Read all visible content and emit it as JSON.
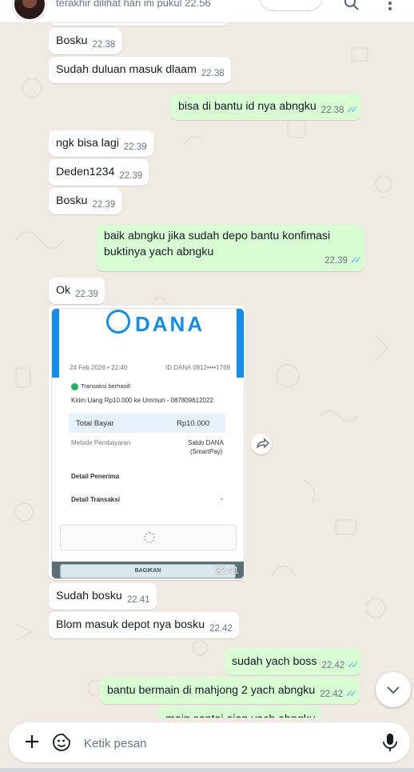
{
  "header": {
    "status": "terakhir dilihat hari ini pukul 22.56"
  },
  "messages": [
    {
      "dir": "in",
      "text": "Bosku",
      "time": "22.38"
    },
    {
      "dir": "in",
      "text": "Sudah duluan masuk dlaam",
      "time": "22.38"
    },
    {
      "dir": "out",
      "text": "bisa di bantu id nya abngku",
      "time": "22.38",
      "status": "read"
    },
    {
      "dir": "in",
      "text": "ngk bisa lagi",
      "time": "22.39"
    },
    {
      "dir": "in",
      "text": "Deden1234",
      "time": "22.39"
    },
    {
      "dir": "in",
      "text": "Bosku",
      "time": "22.39"
    },
    {
      "dir": "out",
      "text": "baik abngku jika sudah depo bantu konfimasi buktinya yach abngku",
      "time": "22.39",
      "status": "read"
    },
    {
      "dir": "in",
      "text": "Ok",
      "time": "22.39"
    },
    {
      "dir": "in",
      "text": "Sudah bosku",
      "time": "22.41"
    },
    {
      "dir": "in",
      "text": "Blom masuk depot nya bosku",
      "time": "22.42"
    },
    {
      "dir": "out",
      "text": "sudah yach boss",
      "time": "22.42",
      "status": "read"
    },
    {
      "dir": "out",
      "text": "bantu bermain di mahjong 2 yach abngku",
      "time": "22.42",
      "status": "read"
    },
    {
      "dir": "out",
      "text": "main santai ajan yach abngku",
      "time": ""
    }
  ],
  "image_message": {
    "time": "22.41",
    "receipt": {
      "brand": "DANA",
      "date": "24 Feb 2026 • 22:40",
      "id_label": "ID DANA 0812••••1769",
      "status": "Transaksi berhasil!",
      "description": "Kirim Uang Rp10.000 ke Ummun - 087809612022",
      "total_label": "Total Bayar",
      "total_value": "Rp10.000",
      "method_label": "Metode Pembayaran",
      "method_value_1": "Saldo DANA",
      "method_value_2": "(SmartPay)",
      "recipient_label": "Detail Penerima",
      "transaction_label": "Detail Transaksi",
      "share_label": "BAGIKAN"
    }
  },
  "composer": {
    "placeholder": "Ketik pesan"
  },
  "icons": {
    "attach": "plus-icon",
    "sticker": "sticker-icon",
    "mic": "microphone-icon",
    "scroll": "chevron-down-icon",
    "forward": "forward-icon",
    "read": "double-check-icon"
  },
  "colors": {
    "outgoing": "#d9fdd3",
    "incoming": "#ffffff",
    "background": "#efeae2",
    "read_ticks": "#53bdeb",
    "dana_blue": "#118ee9"
  }
}
